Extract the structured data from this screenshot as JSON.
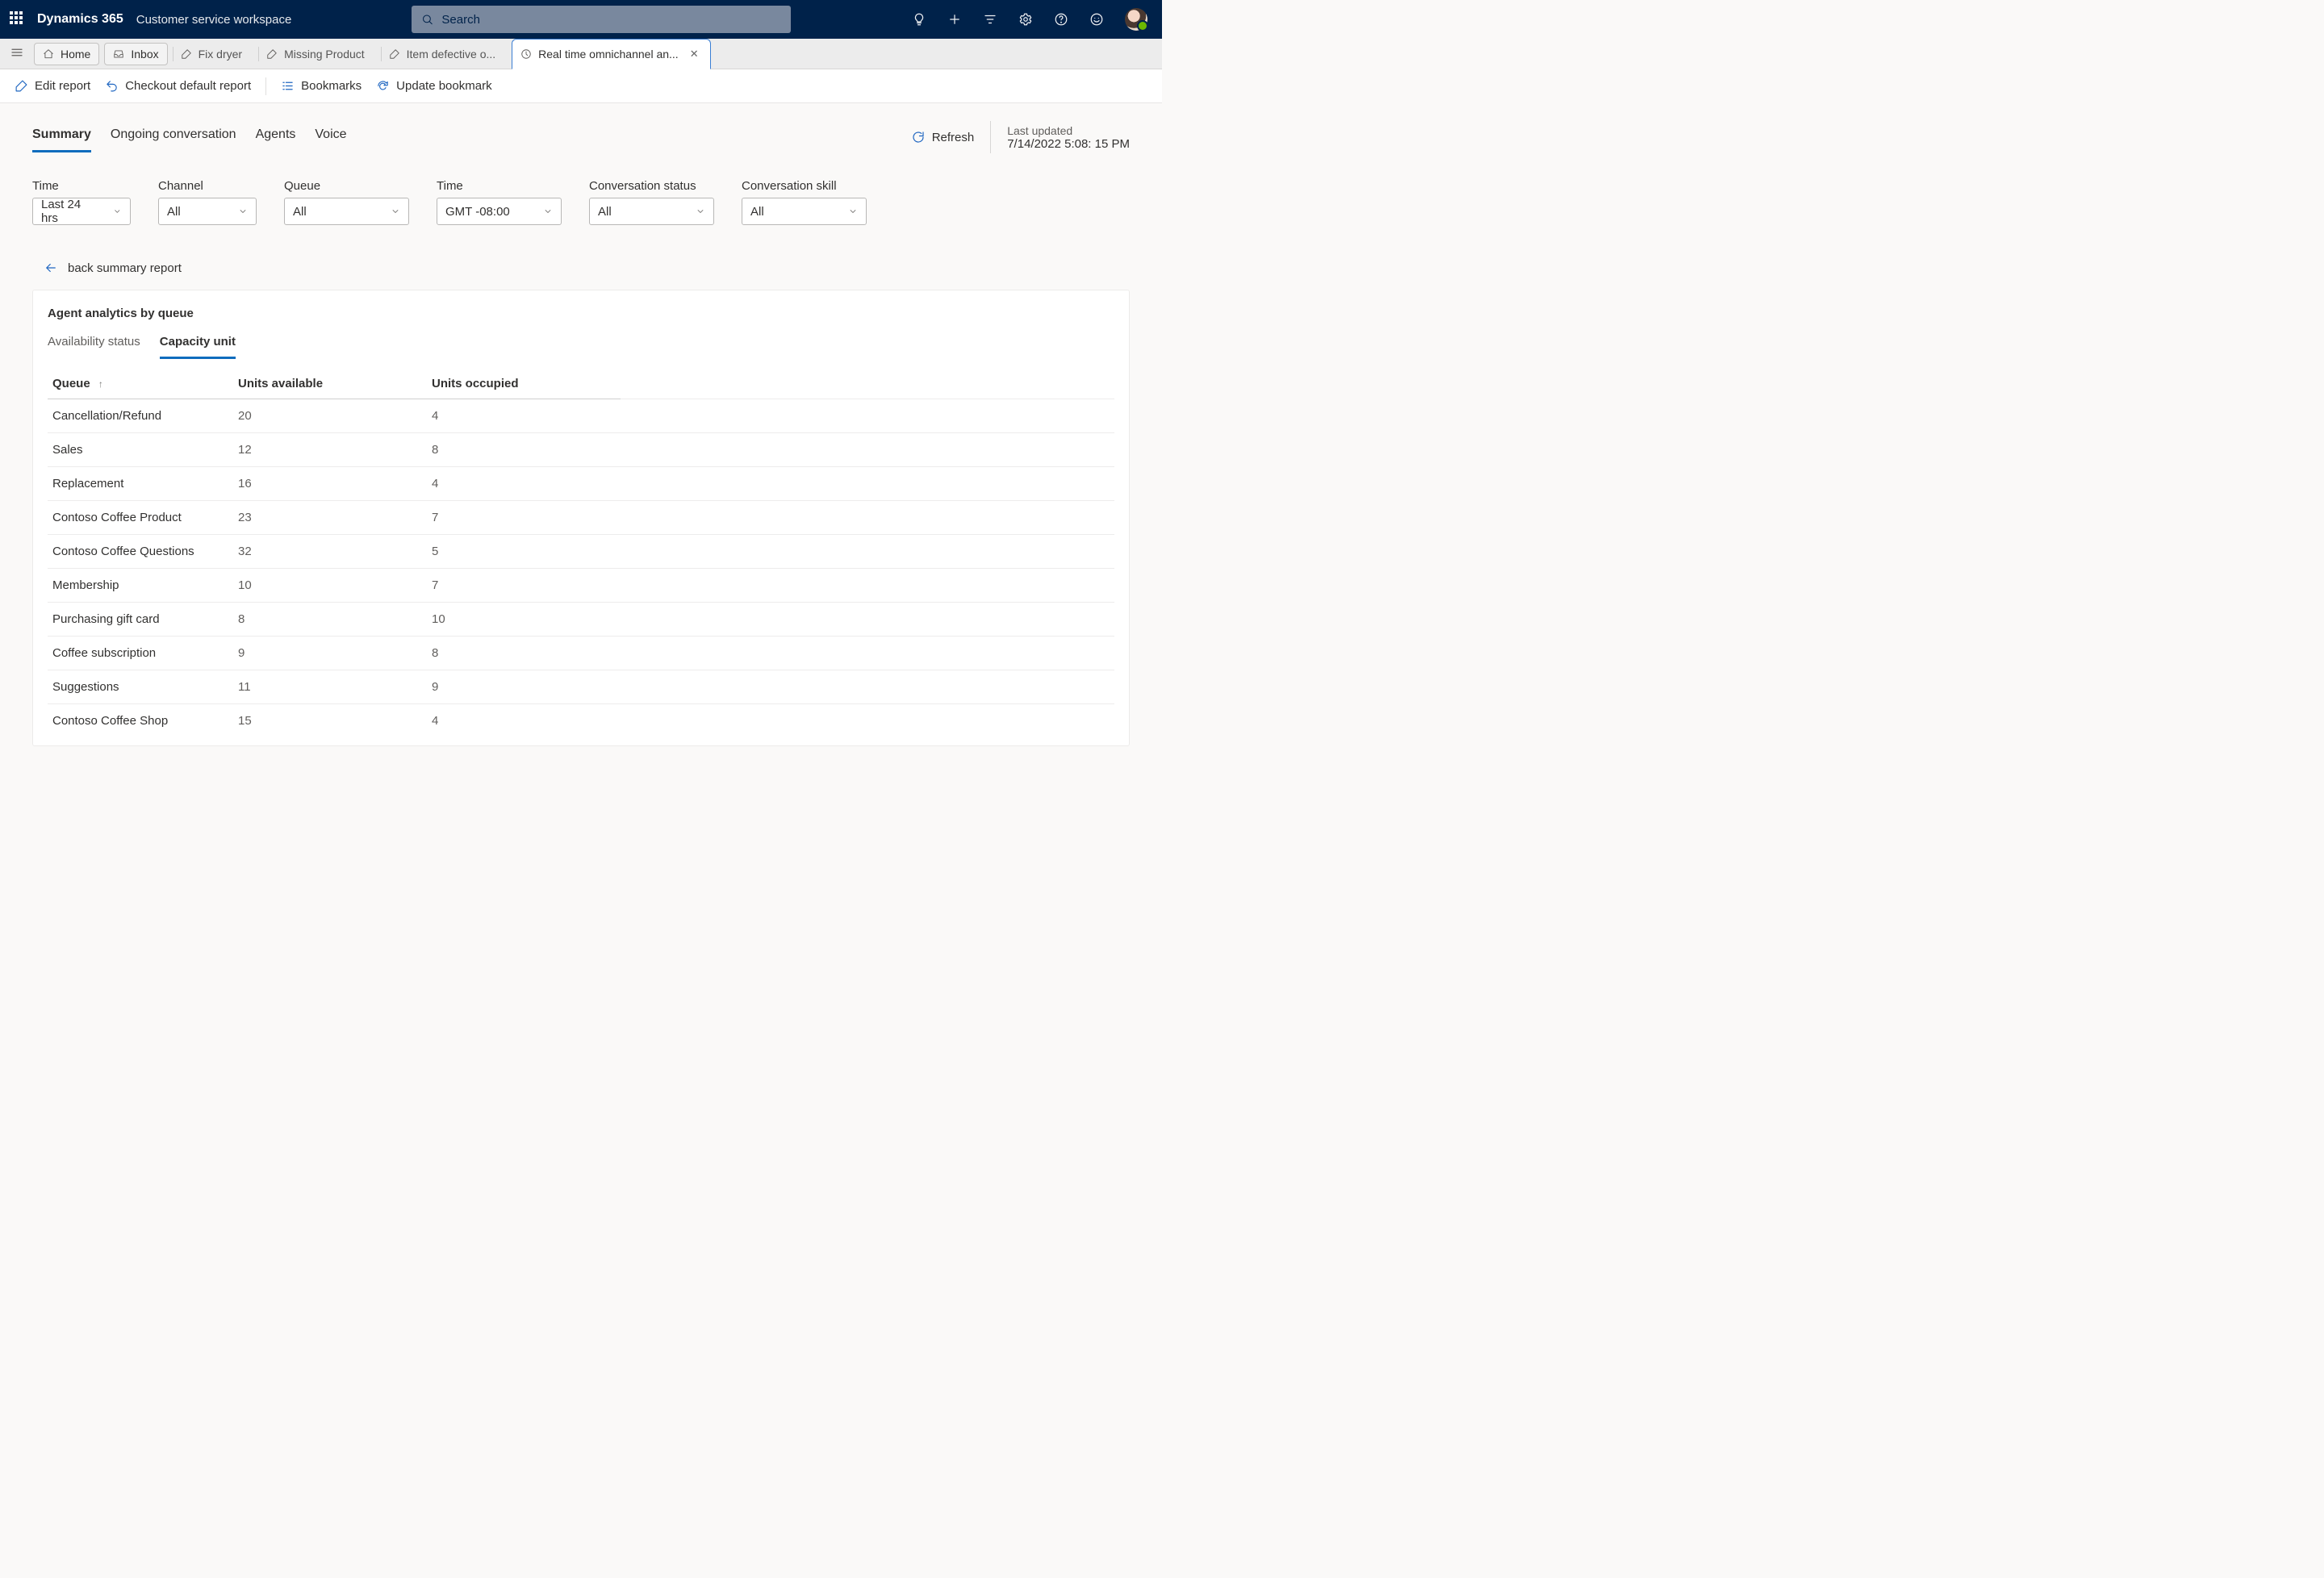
{
  "header": {
    "brand": "Dynamics 365",
    "workspace": "Customer service workspace",
    "search_placeholder": "Search"
  },
  "tabs": {
    "home": "Home",
    "inbox": "Inbox",
    "items": [
      {
        "label": "Fix dryer"
      },
      {
        "label": "Missing Product"
      },
      {
        "label": "Item defective o..."
      },
      {
        "label": "Real time omnichannel an...",
        "active": true
      }
    ]
  },
  "toolbar": {
    "edit_report": "Edit report",
    "checkout_default": "Checkout default report",
    "bookmarks": "Bookmarks",
    "update_bookmark": "Update bookmark"
  },
  "view_tabs": {
    "summary": "Summary",
    "ongoing": "Ongoing conversation",
    "agents": "Agents",
    "voice": "Voice"
  },
  "refresh": {
    "label": "Refresh",
    "last_updated_label": "Last updated",
    "last_updated_value": "7/14/2022 5:08: 15 PM"
  },
  "filters": {
    "time": {
      "label": "Time",
      "value": "Last 24 hrs"
    },
    "channel": {
      "label": "Channel",
      "value": "All"
    },
    "queue": {
      "label": "Queue",
      "value": "All"
    },
    "timezone": {
      "label": "Time",
      "value": "GMT -08:00"
    },
    "status": {
      "label": "Conversation status",
      "value": "All"
    },
    "skill": {
      "label": "Conversation skill",
      "value": "All"
    }
  },
  "back_link": "back summary report",
  "card": {
    "title": "Agent analytics by queue",
    "inner_tabs": {
      "availability": "Availability status",
      "capacity": "Capacity unit"
    },
    "columns": {
      "queue": "Queue",
      "available": "Units available",
      "occupied": "Units occupied"
    },
    "rows": [
      {
        "queue": "Cancellation/Refund",
        "available": "20",
        "occupied": "4"
      },
      {
        "queue": "Sales",
        "available": "12",
        "occupied": "8"
      },
      {
        "queue": "Replacement",
        "available": "16",
        "occupied": "4"
      },
      {
        "queue": "Contoso Coffee Product",
        "available": "23",
        "occupied": "7"
      },
      {
        "queue": "Contoso Coffee Questions",
        "available": "32",
        "occupied": "5"
      },
      {
        "queue": "Membership",
        "available": "10",
        "occupied": "7"
      },
      {
        "queue": "Purchasing gift card",
        "available": "8",
        "occupied": "10"
      },
      {
        "queue": "Coffee subscription",
        "available": "9",
        "occupied": "8"
      },
      {
        "queue": "Suggestions",
        "available": "11",
        "occupied": "9"
      },
      {
        "queue": "Contoso Coffee Shop",
        "available": "15",
        "occupied": "4"
      }
    ]
  }
}
